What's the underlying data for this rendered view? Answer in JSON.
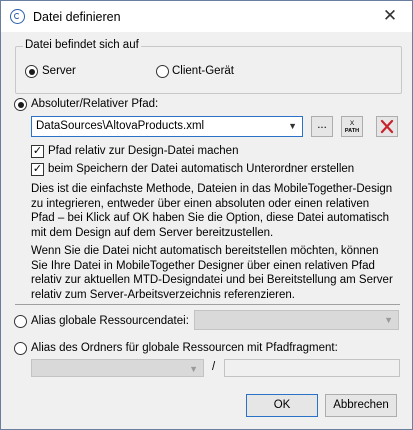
{
  "window": {
    "title": "Datei definieren",
    "close_glyph": "✕"
  },
  "location": {
    "legend": "Datei befindet sich auf",
    "server_label": "Server",
    "client_label": "Client-Gerät",
    "selected": "server"
  },
  "absolute_path": {
    "label": "Absoluter/Relativer Pfad:",
    "selected": true,
    "value": "DataSources\\AltovaProducts.xml",
    "browse_label": "...",
    "xpath_icon": "xpath-icon",
    "delete_icon": "delete-x-icon",
    "delete_color": "#c8232c"
  },
  "options": {
    "relative_label": "Pfad relativ zur Design-Datei machen",
    "relative_checked": true,
    "subfolders_label": "beim Speichern der Datei automatisch Unterordner erstellen",
    "subfolders_checked": true
  },
  "description": {
    "para1": "Dies ist die einfachste Methode, Dateien in das MobileTogether-Design zu integrieren, entweder über einen absoluten oder einen relativen Pfad – bei Klick auf OK haben Sie die Option, diese Datei automatisch mit dem Design auf dem Server bereitzustellen.",
    "para2": "Wenn Sie die Datei nicht automatisch bereitstellen möchten, können Sie Ihre Datei in MobileTogether Designer über einen relativen Pfad relativ zur aktuellen MTD-Designdatei und bei Bereitstellung am Server relativ zum Server-Arbeitsverzeichnis referenzieren."
  },
  "alias_global": {
    "label": "Alias globale Ressourcendatei:",
    "value": ""
  },
  "alias_folder": {
    "label": "Alias des Ordners für globale Ressourcen mit Pfadfragment:",
    "separator": "/",
    "value": "",
    "fragment": ""
  },
  "buttons": {
    "ok": "OK",
    "cancel": "Abbrechen"
  }
}
